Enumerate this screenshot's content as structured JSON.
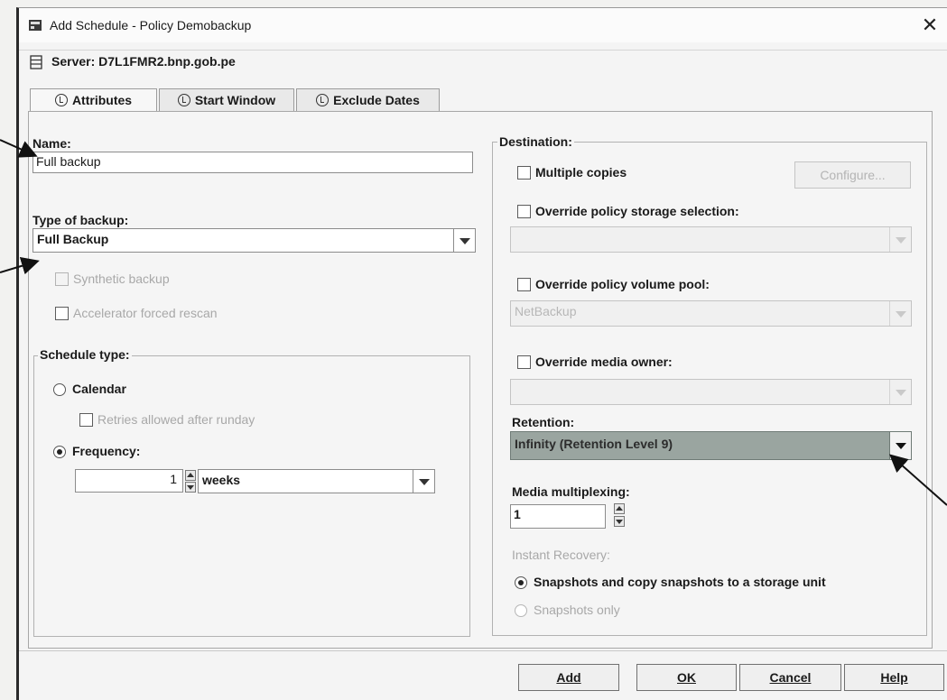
{
  "window": {
    "title": "Add Schedule - Policy Demobackup"
  },
  "server": {
    "label": "Server: D7L1FMR2.bnp.gob.pe"
  },
  "tabs": [
    {
      "label": "Attributes",
      "active": true
    },
    {
      "label": "Start Window",
      "active": false
    },
    {
      "label": "Exclude Dates",
      "active": false
    }
  ],
  "left": {
    "name_label": "Name:",
    "name_value": "Full backup",
    "type_label": "Type of backup:",
    "type_value": "Full Backup",
    "synthetic_label": "Synthetic backup",
    "accelerator_label": "Accelerator forced rescan",
    "schedule_type": {
      "title": "Schedule type:",
      "calendar_label": "Calendar",
      "retries_label": "Retries allowed after runday",
      "frequency_label": "Frequency:",
      "frequency_value": "1",
      "frequency_unit": "weeks"
    }
  },
  "destination": {
    "title": "Destination:",
    "multiple_copies_label": "Multiple copies",
    "configure_label": "Configure...",
    "override_storage_label": "Override policy storage selection:",
    "override_storage_value": "",
    "override_volume_label": "Override policy volume pool:",
    "override_volume_value": "NetBackup",
    "override_media_label": "Override media owner:",
    "override_media_value": "",
    "retention_label": "Retention:",
    "retention_value": "Infinity (Retention Level 9)",
    "multiplexing_label": "Media multiplexing:",
    "multiplexing_value": "1",
    "instant_recovery_label": "Instant Recovery:",
    "snap_copy_label": "Snapshots and copy snapshots to a storage unit",
    "snap_only_label": "Snapshots only"
  },
  "buttons": {
    "add": "Add",
    "ok": "OK",
    "cancel": "Cancel",
    "help": "Help"
  },
  "colors": {
    "retention_bg": "#9aa5a0",
    "disabled_text": "#a8a8a8"
  }
}
